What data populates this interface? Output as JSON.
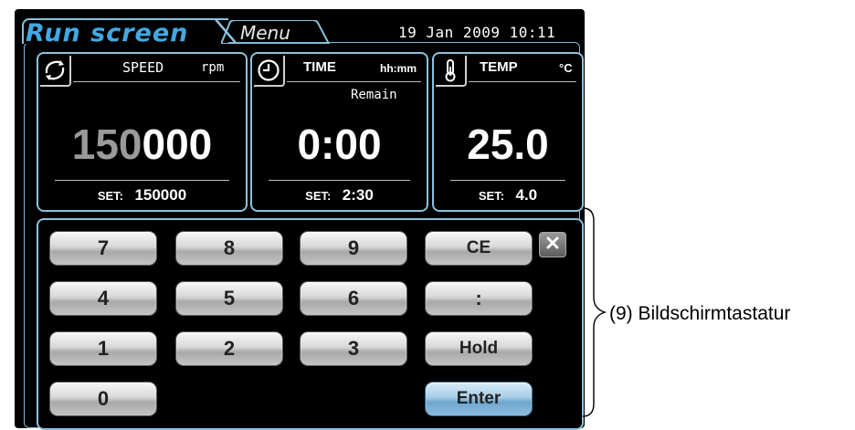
{
  "header": {
    "run_tab_label": "Run screen",
    "menu_tab_label": "Menu",
    "datetime": "19 Jan 2009 10:11"
  },
  "panels": {
    "speed": {
      "title": "SPEED",
      "unit": "rpm",
      "value_dim": "150",
      "value_bright": "000",
      "set_label": "SET:",
      "set_value": "150000",
      "icon": "rotation-arrows-icon"
    },
    "time": {
      "title": "TIME",
      "unit": "hh:mm",
      "sublabel": "Remain",
      "value": "0:00",
      "set_label": "SET:",
      "set_value": "2:30",
      "icon": "clock-icon"
    },
    "temp": {
      "title": "TEMP",
      "unit": "°C",
      "value": "25.0",
      "set_label": "SET:",
      "set_value": "4.0",
      "icon": "thermometer-icon"
    }
  },
  "keypad": {
    "keys": {
      "k7": "7",
      "k8": "8",
      "k9": "9",
      "ce": "CE",
      "k4": "4",
      "k5": "5",
      "k6": "6",
      "colon": ":",
      "k1": "1",
      "k2": "2",
      "k3": "3",
      "hold": "Hold",
      "k0": "0",
      "enter": "Enter"
    },
    "close_icon": "close-icon"
  },
  "annotation": {
    "label": "(9) Bildschirmtastatur"
  },
  "colors": {
    "accent_blue": "#41a9e3",
    "frame_blue": "#8ac2df",
    "enter_blue": "#8dbbe0"
  }
}
